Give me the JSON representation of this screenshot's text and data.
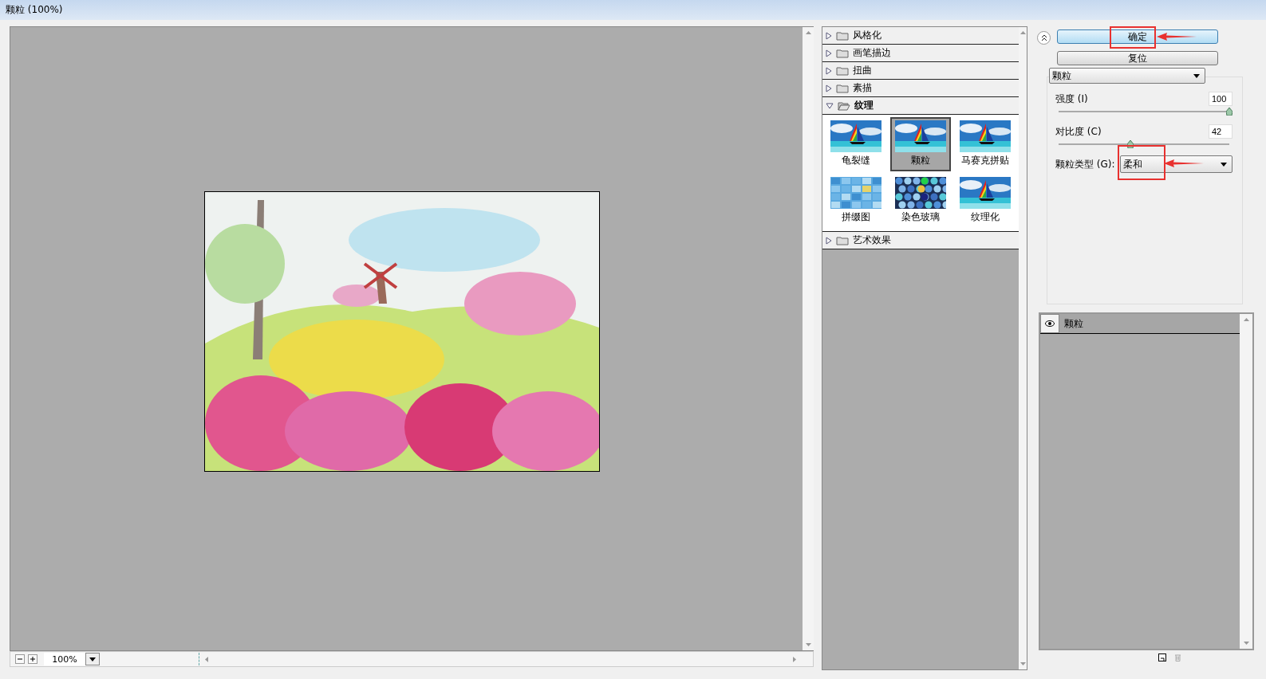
{
  "window": {
    "title": "颗粒 (100%)"
  },
  "preview": {
    "zoom": "100%"
  },
  "filter_groups": [
    {
      "label": "风格化",
      "expanded": false
    },
    {
      "label": "画笔描边",
      "expanded": false
    },
    {
      "label": "扭曲",
      "expanded": false
    },
    {
      "label": "素描",
      "expanded": false
    },
    {
      "label": "纹理",
      "expanded": true,
      "filters": [
        {
          "label": "龟裂缝",
          "selected": false,
          "kind": "sailboat"
        },
        {
          "label": "颗粒",
          "selected": true,
          "kind": "sailboat"
        },
        {
          "label": "马赛克拼贴",
          "selected": false,
          "kind": "sailboat"
        },
        {
          "label": "拼缀图",
          "selected": false,
          "kind": "tiles"
        },
        {
          "label": "染色玻璃",
          "selected": false,
          "kind": "cells"
        },
        {
          "label": "纹理化",
          "selected": false,
          "kind": "sailboat"
        }
      ]
    },
    {
      "label": "艺术效果",
      "expanded": false
    }
  ],
  "buttons": [
    {
      "label": "确定",
      "default": true,
      "highlighted": true
    },
    {
      "label": "复位",
      "default": false,
      "highlighted": false
    }
  ],
  "filter_select": {
    "value": "颗粒"
  },
  "sliders": [
    {
      "label": "强度 (I)",
      "value": "100",
      "level": 1.0
    },
    {
      "label": "对比度 (C)",
      "value": "42",
      "level": 0.42
    }
  ],
  "grain_type": {
    "label": "颗粒类型 (G):",
    "value": "柔和",
    "highlighted": true
  },
  "layers": [
    {
      "label": "颗粒",
      "visible": true
    }
  ]
}
